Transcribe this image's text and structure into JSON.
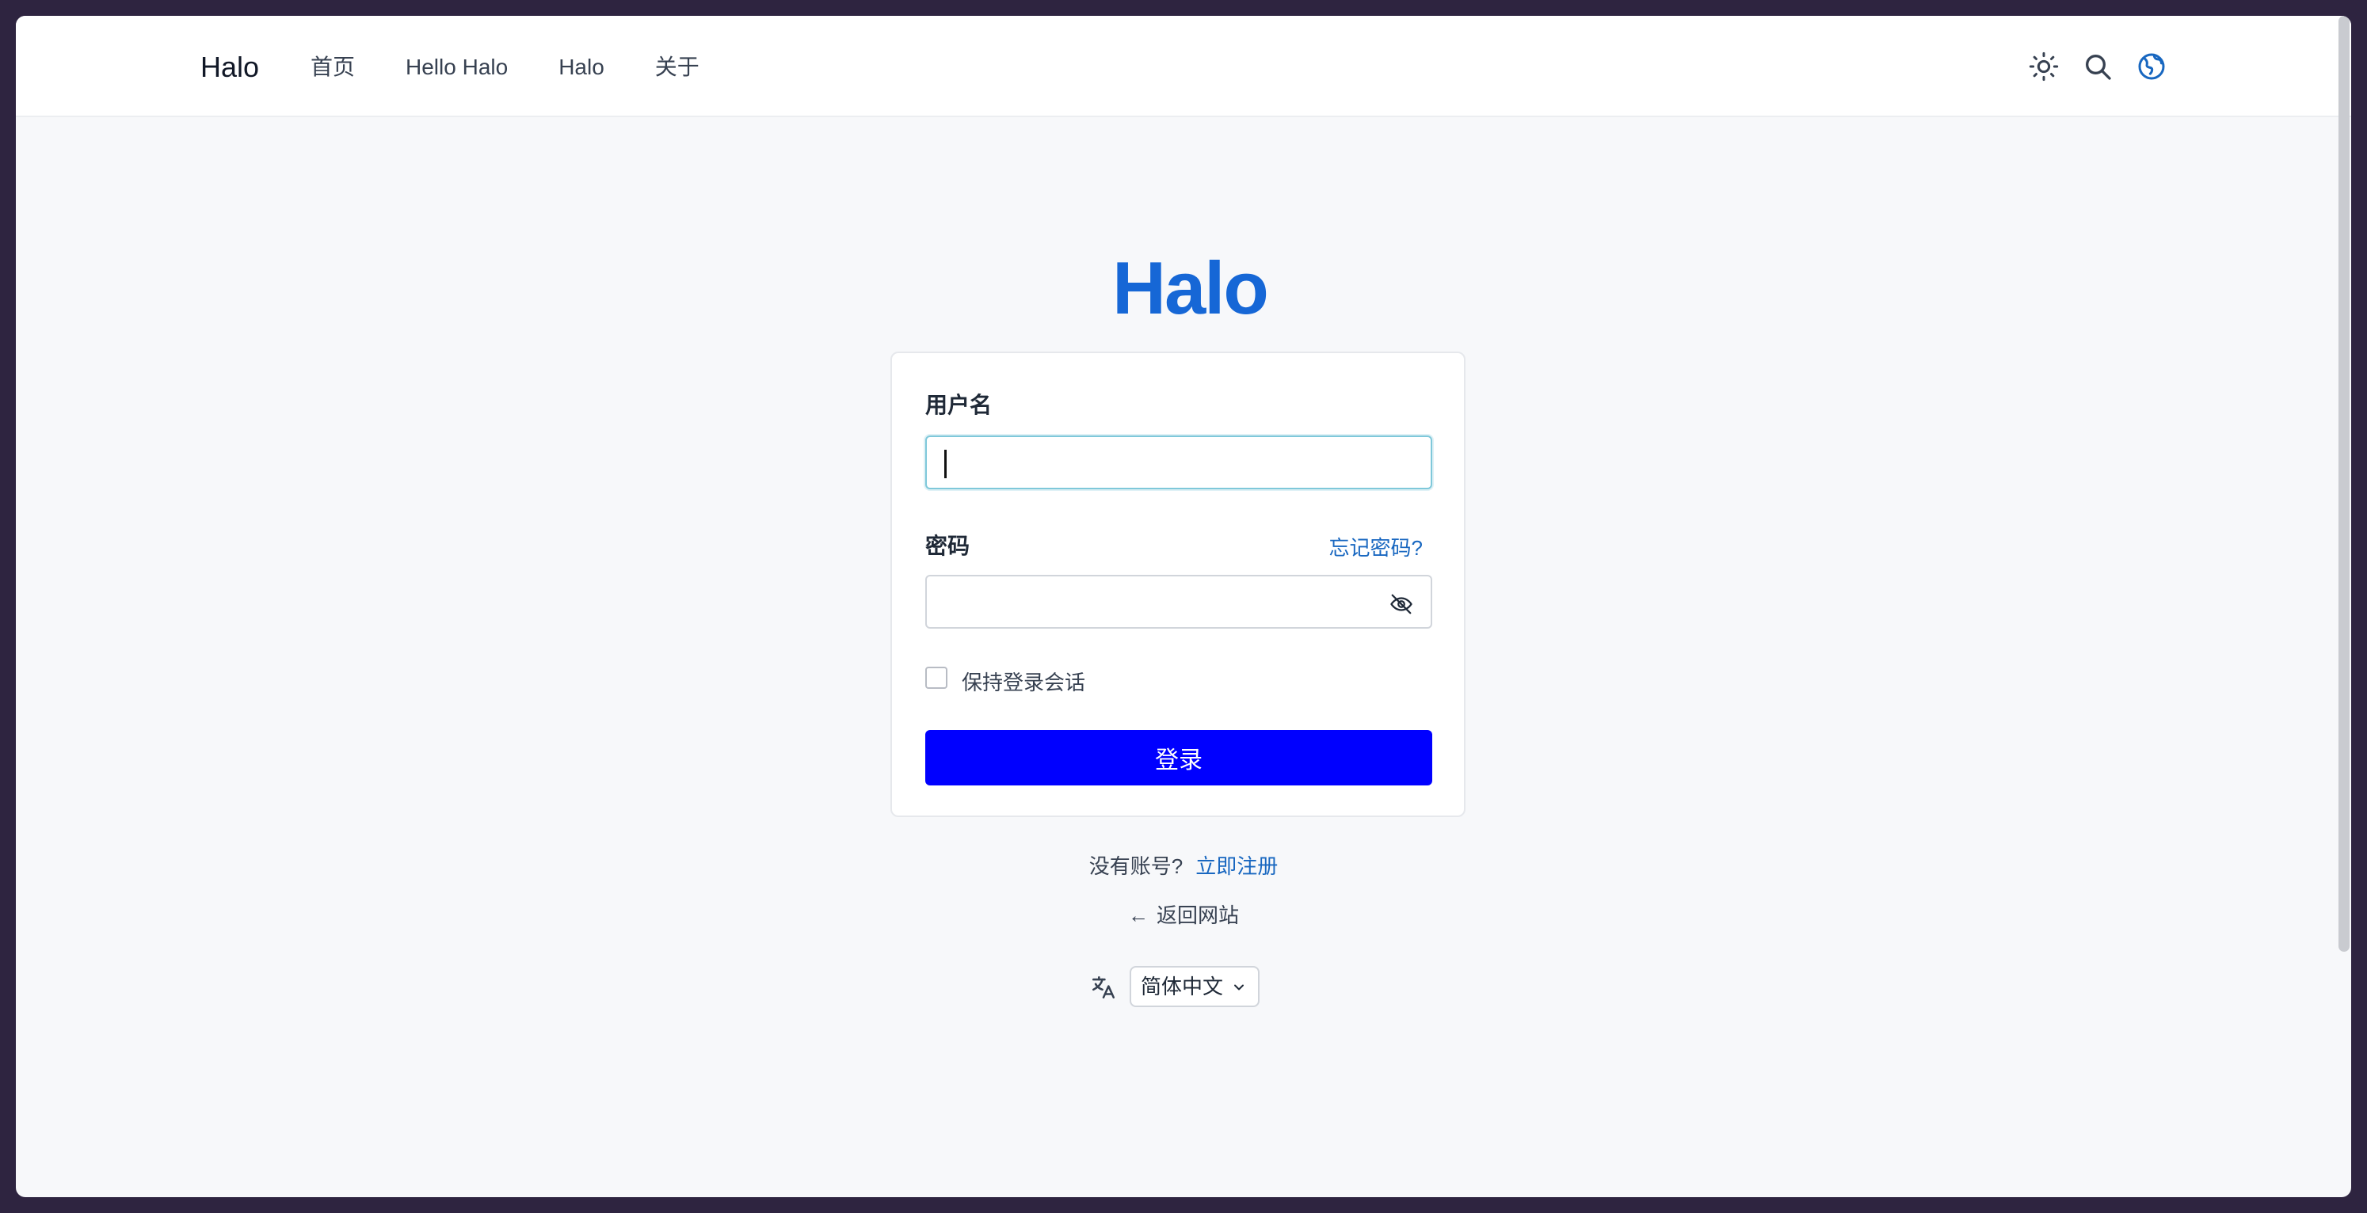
{
  "header": {
    "brand": "Halo",
    "nav": [
      "首页",
      "Hello Halo",
      "Halo",
      "关于"
    ],
    "icons": [
      "sun-icon",
      "search-icon",
      "globe-icon"
    ]
  },
  "logo": "Halo",
  "form": {
    "username_label": "用户名",
    "username_value": "",
    "password_label": "密码",
    "forgot_password": "忘记密码?",
    "password_value": "",
    "remember_label": "保持登录会话",
    "remember_checked": false,
    "login_button": "登录"
  },
  "footer": {
    "no_account": "没有账号?",
    "register_link": "立即注册",
    "back_arrow": "←",
    "back_link": "返回网站",
    "language": "简体中文"
  },
  "colors": {
    "accent": "#1867c0",
    "primary_button": "#0000ff",
    "logo": "#1667d6"
  }
}
